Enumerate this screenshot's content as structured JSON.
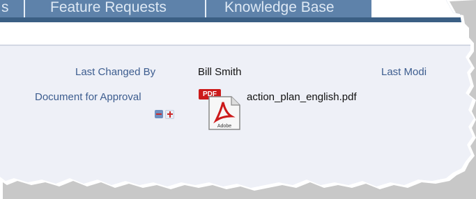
{
  "tabs": [
    {
      "label": "s"
    },
    {
      "label": "Feature Requests"
    },
    {
      "label": "Knowledge Base"
    }
  ],
  "fields": {
    "last_changed_by_label": "Last Changed By",
    "last_changed_by_value": "Bill Smith",
    "last_modified_label": "Last Modi",
    "document_label": "Document for Approval",
    "document_filename": "action_plan_english.pdf"
  },
  "icons": {
    "pdf_badge": "PDF",
    "remove": "minus-icon",
    "add": "plus-icon",
    "adobe": "Adobe"
  },
  "colors": {
    "tab_bar": "#5e82aa",
    "nav_line": "#3b5f84",
    "label_text": "#3d5d8f",
    "content_bg": "#eef0f7",
    "pdf_red": "#cc1a1a"
  }
}
